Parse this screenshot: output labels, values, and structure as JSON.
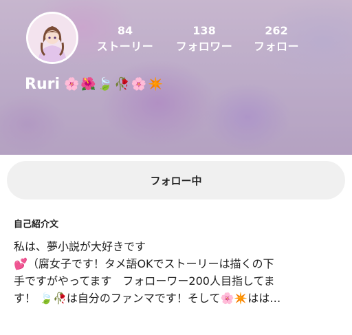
{
  "profile": {
    "username": "Ruri",
    "name_emojis": [
      "🌸",
      "🌺",
      "🍃",
      "🥀",
      "🌸",
      "✴️"
    ],
    "stats": [
      {
        "value": "84",
        "label": "ストーリー"
      },
      {
        "value": "138",
        "label": "フォロワー"
      },
      {
        "value": "262",
        "label": "フォロー"
      }
    ]
  },
  "follow_button": {
    "label": "フォロー中"
  },
  "bio": {
    "heading": "自己紹介文",
    "lines": [
      "私は、夢小説が大好きです",
      "💕（腐女子です！タメ語OKでストーリーは描くの下",
      "手ですがやってます　フォローワー200人目指してま",
      "す！ 🍃🥀は自分のファンマです！そして🌸✴️はは…"
    ]
  },
  "colors": {
    "header_overlay": "#7a6884",
    "button_bg": "#f0f0f0",
    "text": "#222222"
  }
}
